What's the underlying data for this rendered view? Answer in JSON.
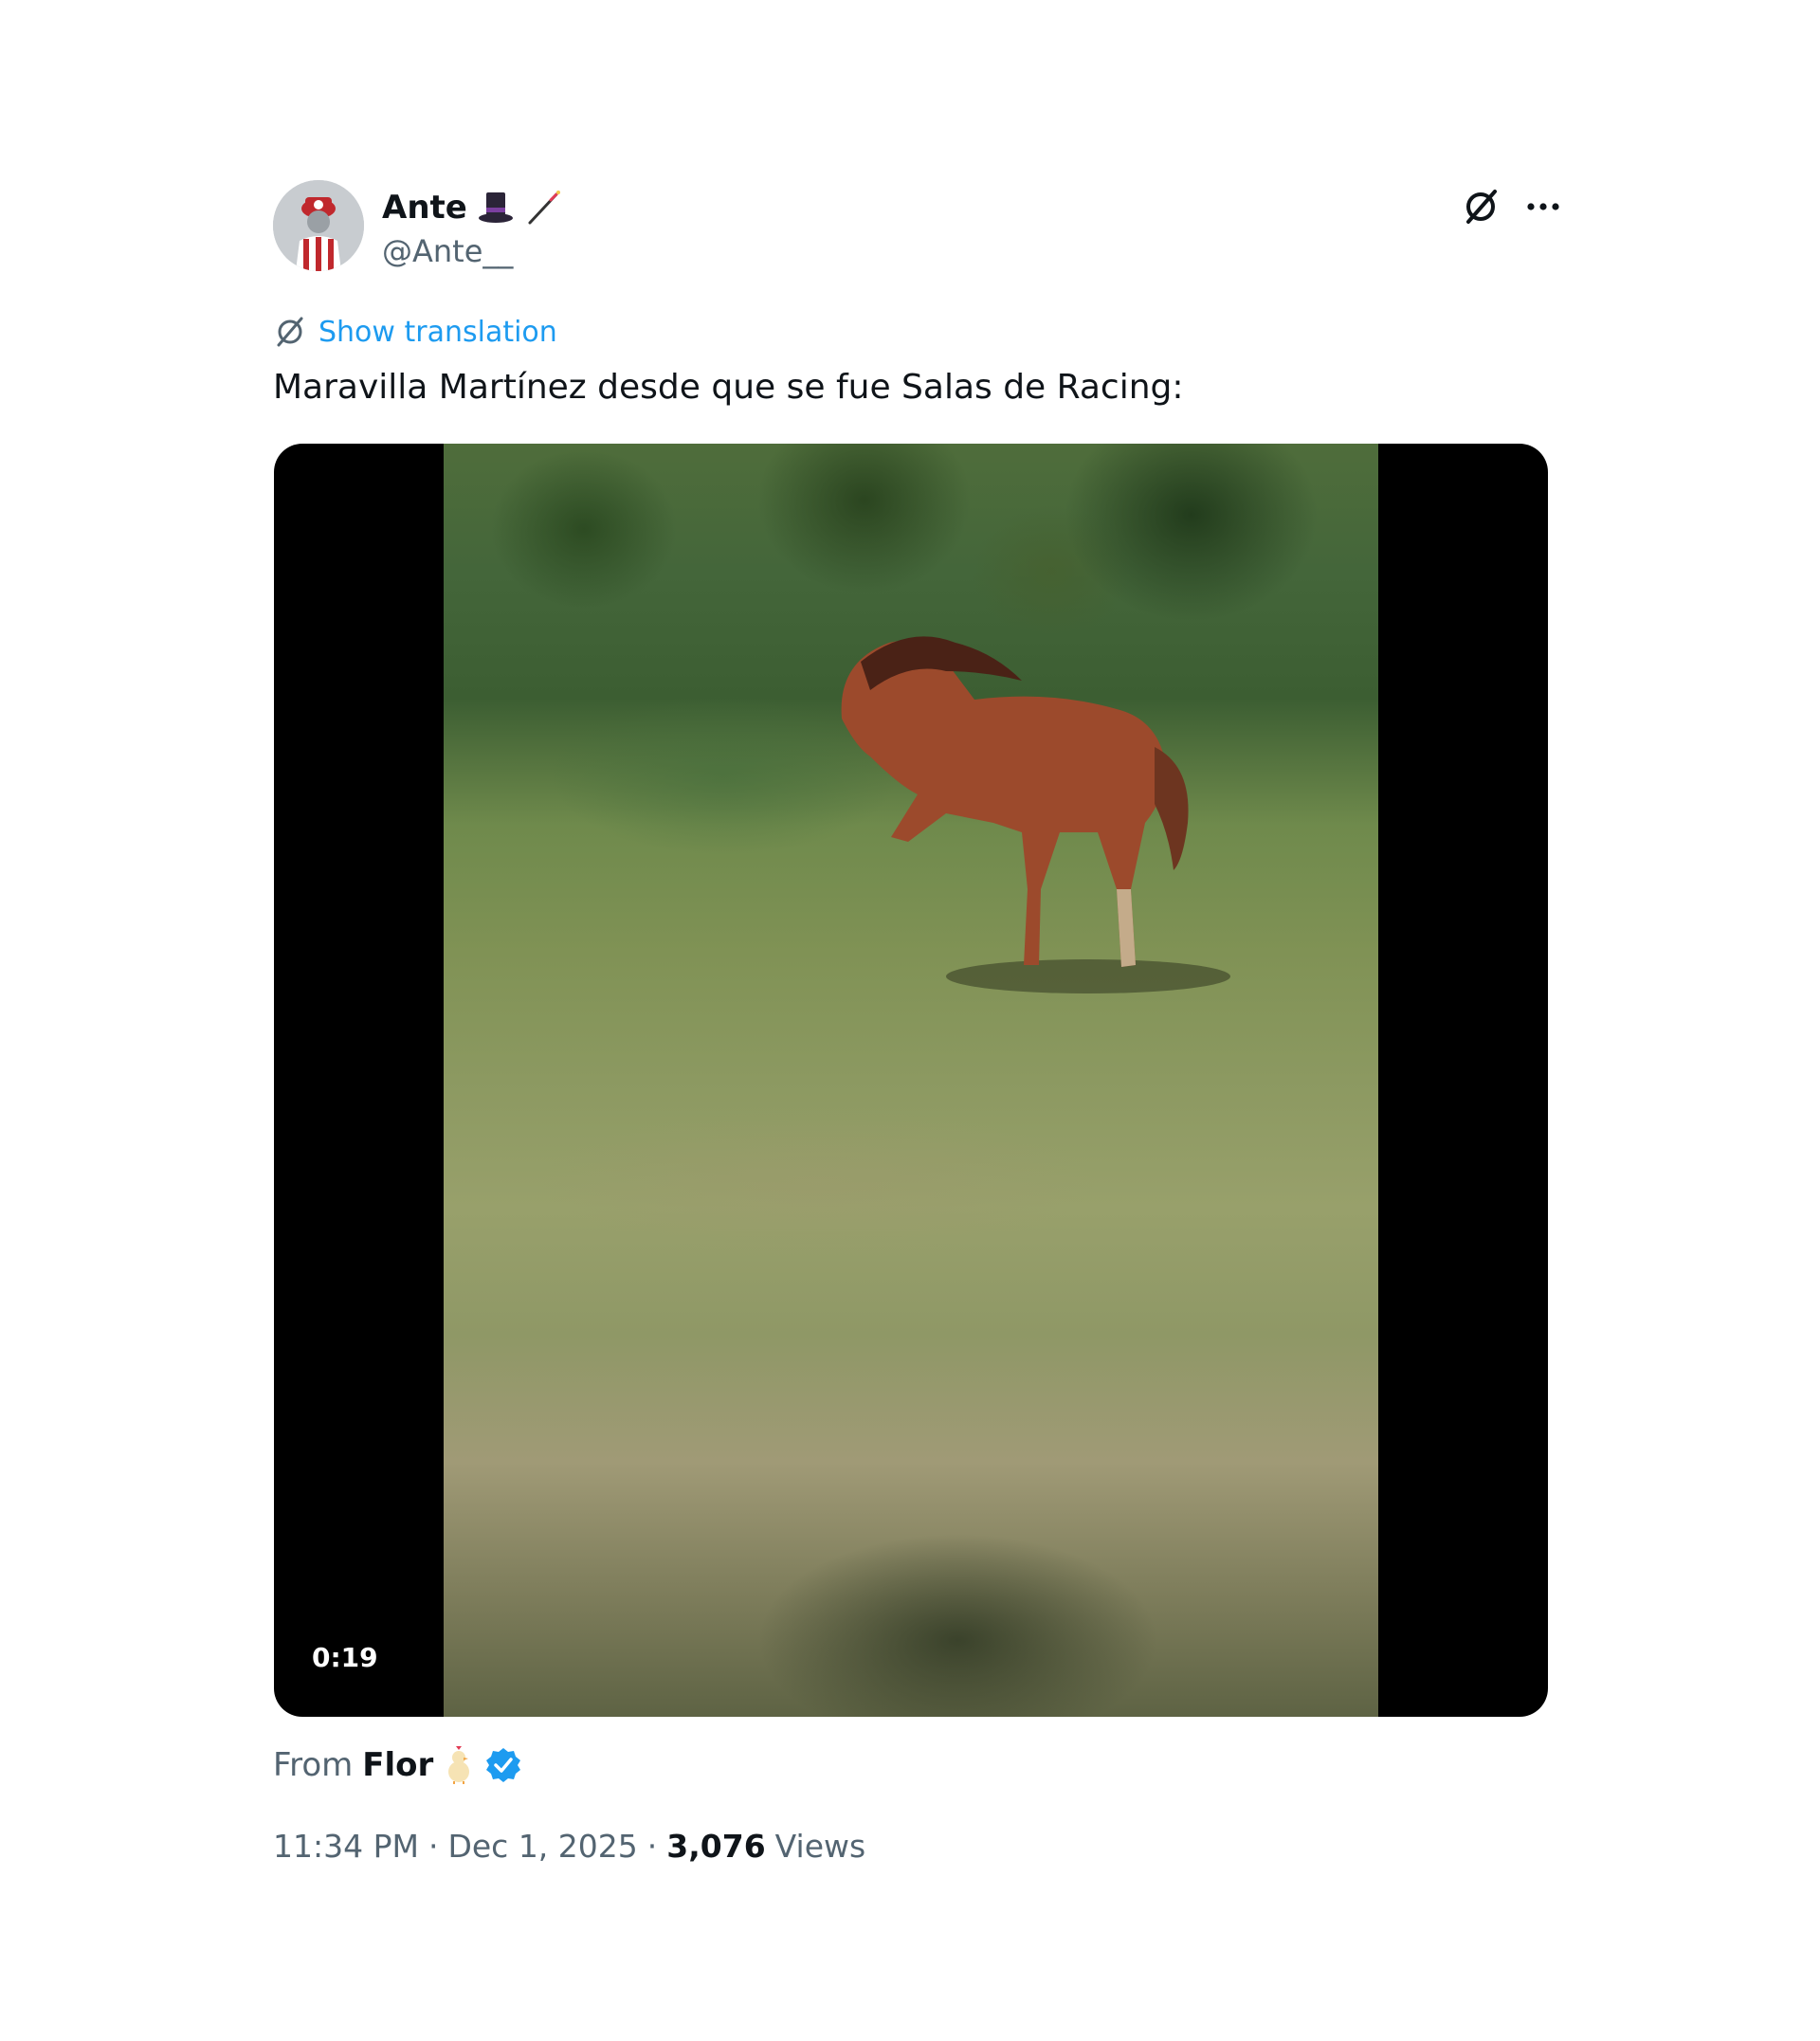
{
  "author": {
    "display_name": "Ante",
    "name_emojis": [
      "top-hat",
      "magic-wand"
    ],
    "handle": "@Ante__",
    "avatar_icon": "racing-mascot-avatar"
  },
  "actions": {
    "grok_icon": "grok-icon",
    "more_icon": "more-dots-icon"
  },
  "translation": {
    "label": "Show translation",
    "icon": "grok-icon"
  },
  "tweet": {
    "text": "Maravilla Martínez desde que se fue Salas de Racing:"
  },
  "media": {
    "duration": "0:19"
  },
  "from": {
    "label": "From",
    "name": "Flor",
    "name_emoji": "chick",
    "verified": true
  },
  "meta": {
    "time": "11:34 PM",
    "separator": "·",
    "date": "Dec 1, 2025",
    "views_count": "3,076",
    "views_label": "Views"
  },
  "colors": {
    "accent": "#1d9bf0",
    "text_primary": "#0f1419",
    "text_secondary": "#536471",
    "verified_badge": "#1d9bf0"
  }
}
